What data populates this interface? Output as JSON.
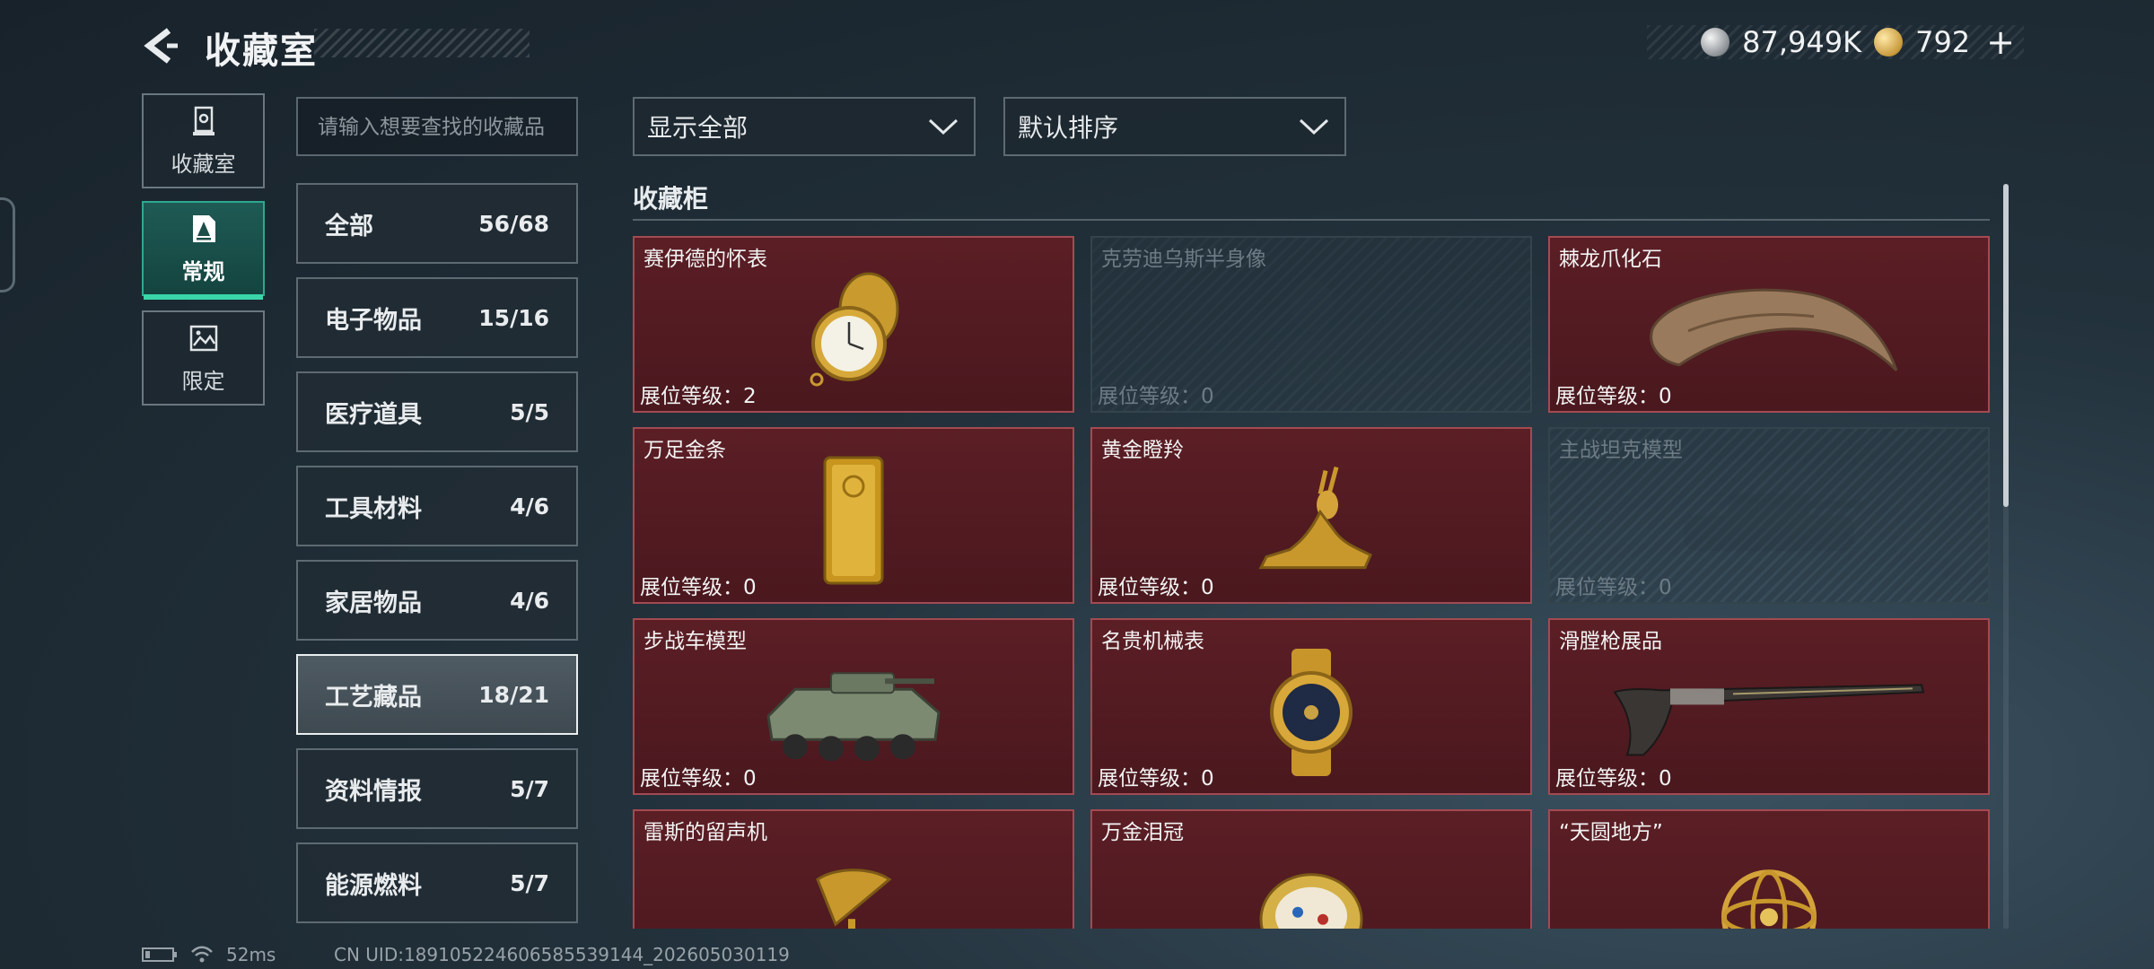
{
  "header": {
    "title": "收藏室",
    "silver_amount": "87,949K",
    "gold_amount": "792",
    "plus_label": "+"
  },
  "left_nav": [
    {
      "label": "收藏室",
      "icon": "trophy-icon",
      "active": false
    },
    {
      "label": "常规",
      "icon": "document-icon",
      "active": true
    },
    {
      "label": "限定",
      "icon": "image-icon",
      "active": false
    }
  ],
  "search": {
    "placeholder": "请输入想要查找的收藏品"
  },
  "categories": [
    {
      "label": "全部",
      "count": "56/68"
    },
    {
      "label": "电子物品",
      "count": "15/16"
    },
    {
      "label": "医疗道具",
      "count": "5/5"
    },
    {
      "label": "工具材料",
      "count": "4/6"
    },
    {
      "label": "家居物品",
      "count": "4/6"
    },
    {
      "label": "工艺藏品",
      "count": "18/21",
      "active": true
    },
    {
      "label": "资料情报",
      "count": "5/7"
    },
    {
      "label": "能源燃料",
      "count": "5/7"
    }
  ],
  "filters": {
    "filter_label": "显示全部",
    "sort_label": "默认排序"
  },
  "section": {
    "title": "收藏柜"
  },
  "items": [
    {
      "name": "赛伊德的怀表",
      "level": "展位等级：2",
      "owned": true,
      "icon": "pocket-watch-icon"
    },
    {
      "name": "克劳迪乌斯半身像",
      "level": "展位等级：0",
      "owned": false,
      "icon": "bust-icon"
    },
    {
      "name": "棘龙爪化石",
      "level": "展位等级：0",
      "owned": true,
      "icon": "claw-fossil-icon"
    },
    {
      "name": "万足金条",
      "level": "展位等级：0",
      "owned": true,
      "icon": "gold-bar-icon"
    },
    {
      "name": "黄金瞪羚",
      "level": "展位等级：0",
      "owned": true,
      "icon": "golden-gazelle-icon"
    },
    {
      "name": "主战坦克模型",
      "level": "展位等级：0",
      "owned": false,
      "icon": "tank-model-icon"
    },
    {
      "name": "步战车模型",
      "level": "展位等级：0",
      "owned": true,
      "icon": "ifv-model-icon"
    },
    {
      "name": "名贵机械表",
      "level": "展位等级：0",
      "owned": true,
      "icon": "wristwatch-icon"
    },
    {
      "name": "滑膛枪展品",
      "level": "展位等级：0",
      "owned": true,
      "icon": "musket-icon"
    },
    {
      "name": "雷斯的留声机",
      "level": "",
      "owned": true,
      "icon": "gramophone-icon"
    },
    {
      "name": "万金泪冠",
      "level": "",
      "owned": true,
      "icon": "jeweled-egg-icon"
    },
    {
      "name": "“天圆地方”",
      "level": "",
      "owned": true,
      "icon": "armillary-sphere-icon"
    }
  ],
  "footer": {
    "ping": "52ms",
    "uid": "CN UID:18910522460658553914​4_202605030119"
  },
  "colors": {
    "owned_card": "#4f1a20",
    "accent": "#39d6a8"
  }
}
